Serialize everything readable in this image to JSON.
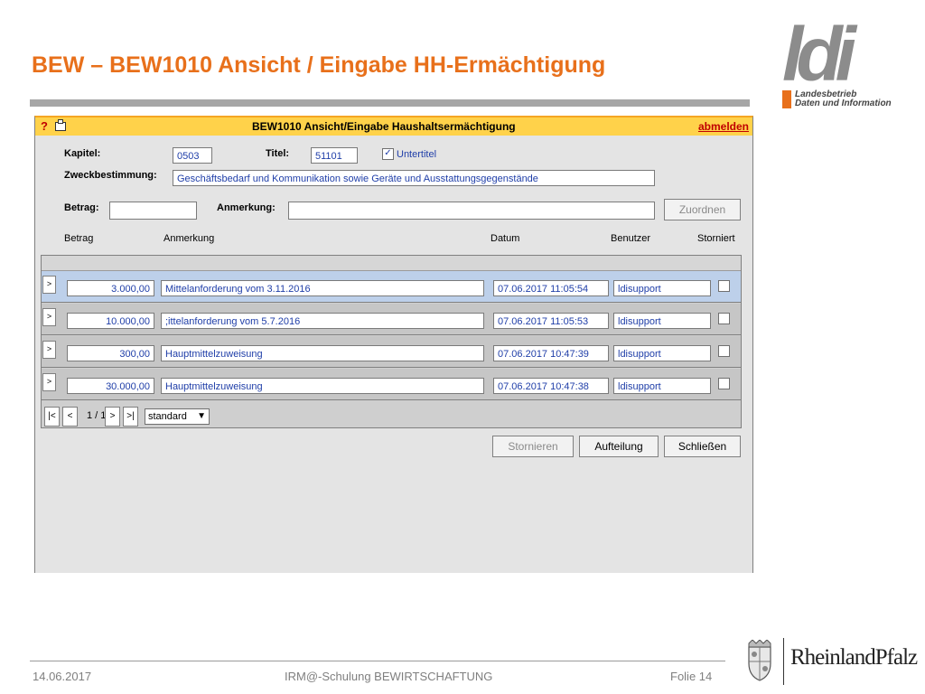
{
  "slide": {
    "title": "BEW – BEW1010 Ansicht / Eingabe HH-Ermächtigung",
    "footer_date": "14.06.2017",
    "footer_center": "IRM@-Schulung BEWIRTSCHAFTUNG",
    "footer_page": "Folie 14"
  },
  "logo": {
    "mark": "ldi",
    "line1": "Landesbetrieb",
    "line2": "Daten und Information",
    "rlp": "RheinlandPfalz"
  },
  "app": {
    "help": "?",
    "title": "BEW1010 Ansicht/Eingabe Haushaltsermächtigung",
    "logout": "abmelden",
    "labels": {
      "kapitel": "Kapitel:",
      "titel": "Titel:",
      "untertitel": "Untertitel",
      "zweck": "Zweckbestimmung:",
      "betrag": "Betrag:",
      "anmerkung": "Anmerkung:"
    },
    "values": {
      "kapitel": "0503",
      "titel": "51101",
      "zweck": "Geschäftsbedarf und Kommunikation sowie Geräte und Ausstattungsgegenstände",
      "betrag": "",
      "anmerkung": ""
    },
    "untertitel_checked": true,
    "zuordnen": "Zuordnen",
    "columns": [
      "Betrag",
      "Anmerkung",
      "Datum",
      "Benutzer",
      "Storniert"
    ],
    "rows": [
      {
        "arrow": ">",
        "betrag": "3.000,00",
        "anmerkung": "Mittelanforderung vom 3.11.2016",
        "datum": "07.06.2017 11:05:54",
        "benutzer": "ldisupport",
        "storniert": false
      },
      {
        "arrow": ">",
        "betrag": "10.000,00",
        "anmerkung": ";ittelanforderung vom 5.7.2016",
        "datum": "07.06.2017 11:05:53",
        "benutzer": "ldisupport",
        "storniert": false
      },
      {
        "arrow": ">",
        "betrag": "300,00",
        "anmerkung": "Hauptmittelzuweisung",
        "datum": "07.06.2017 10:47:39",
        "benutzer": "ldisupport",
        "storniert": false
      },
      {
        "arrow": ">",
        "betrag": "30.000,00",
        "anmerkung": "Hauptmittelzuweisung",
        "datum": "07.06.2017 10:47:38",
        "benutzer": "ldisupport",
        "storniert": false
      }
    ],
    "pager": {
      "first": "|<",
      "prev": "<",
      "info": "1 / 1",
      "next": ">",
      "last": ">|",
      "view": "standard"
    },
    "buttons": {
      "stornieren": "Stornieren",
      "aufteilung": "Aufteilung",
      "schliessen": "Schließen"
    },
    "colors": {
      "title_orange": "#e8701b",
      "app_bar": "#ffd24a",
      "field_text": "#1f3ea8",
      "selected_row": "#bdd0ea"
    }
  }
}
